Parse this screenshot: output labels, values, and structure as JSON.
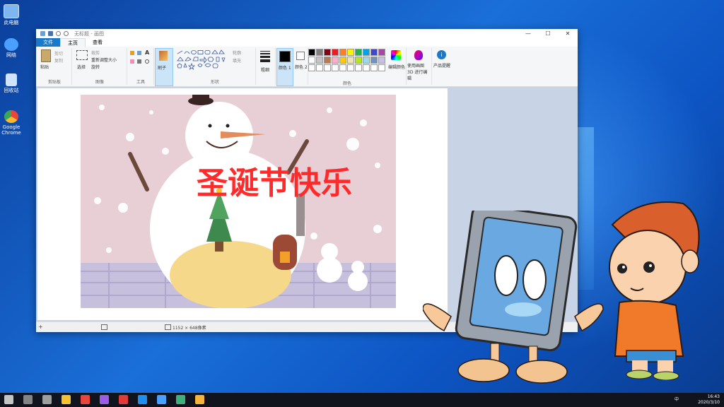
{
  "desktop": {
    "icons": [
      {
        "label": "此电脑",
        "icon": "computer-icon",
        "color": "#7fb6f0"
      },
      {
        "label": "网络",
        "icon": "network-icon",
        "color": "#4aa0ff"
      },
      {
        "label": "回收站",
        "icon": "recycle-bin-icon",
        "color": "#cfe3ff"
      },
      {
        "label": "Google Chrome",
        "icon": "chrome-icon",
        "color": "#e8453c"
      }
    ]
  },
  "window": {
    "title": "无标题 - 画图",
    "controls": {
      "minimize": "—",
      "maximize": "☐",
      "close": "✕"
    }
  },
  "tabs": {
    "file": "文件",
    "home": "主页",
    "view": "查看"
  },
  "ribbon": {
    "clipboard": {
      "paste": "粘贴",
      "cut": "剪切",
      "copy": "复制",
      "label": "剪贴板"
    },
    "image": {
      "select": "选择",
      "crop": "裁剪",
      "resize": "重新调整大小",
      "rotate": "旋转",
      "label": "图像"
    },
    "tools": {
      "label": "工具",
      "text_tool": "A"
    },
    "brushes": "刷子",
    "shapes": {
      "outline": "轮廓",
      "fill": "填充",
      "label": "形状"
    },
    "size": "粗细",
    "color1": "颜色 1",
    "color2": "颜色 2",
    "colors_label": "颜色",
    "edit_colors": "编辑颜色",
    "paint3d": "使用画图 3D 进行编辑",
    "product_alert": "产品提醒",
    "palette": [
      "#000000",
      "#7f7f7f",
      "#880015",
      "#ed1c24",
      "#ff7f27",
      "#fff200",
      "#22b14c",
      "#00a2e8",
      "#3f48cc",
      "#a349a4",
      "#ffffff",
      "#c3c3c3",
      "#b97a57",
      "#ffaec9",
      "#ffc90e",
      "#efe4b0",
      "#b5e61d",
      "#99d9ea",
      "#7092be",
      "#c8bfe7",
      "#ffffff",
      "#ffffff",
      "#ffffff",
      "#ffffff",
      "#ffffff",
      "#ffffff",
      "#ffffff",
      "#ffffff",
      "#ffffff",
      "#ffffff"
    ]
  },
  "canvas": {
    "greeting": "圣诞节快乐",
    "colors": {
      "bg": "#e8cfd6",
      "snow": "#ffffff",
      "plaid": "#c7c0dc",
      "text": "#ff2a2a"
    }
  },
  "status": {
    "dimensions": "1152 × 648像素"
  },
  "taskbar": {
    "time": "16:43",
    "date": "2020/3/10",
    "ime": "中",
    "apps": [
      "start-icon",
      "search-icon",
      "task-view-icon",
      "file-explorer-icon",
      "chrome-icon",
      "premiere-icon",
      "flash-icon",
      "edge-icon",
      "settings-icon",
      "photos-icon",
      "app-icon"
    ]
  }
}
